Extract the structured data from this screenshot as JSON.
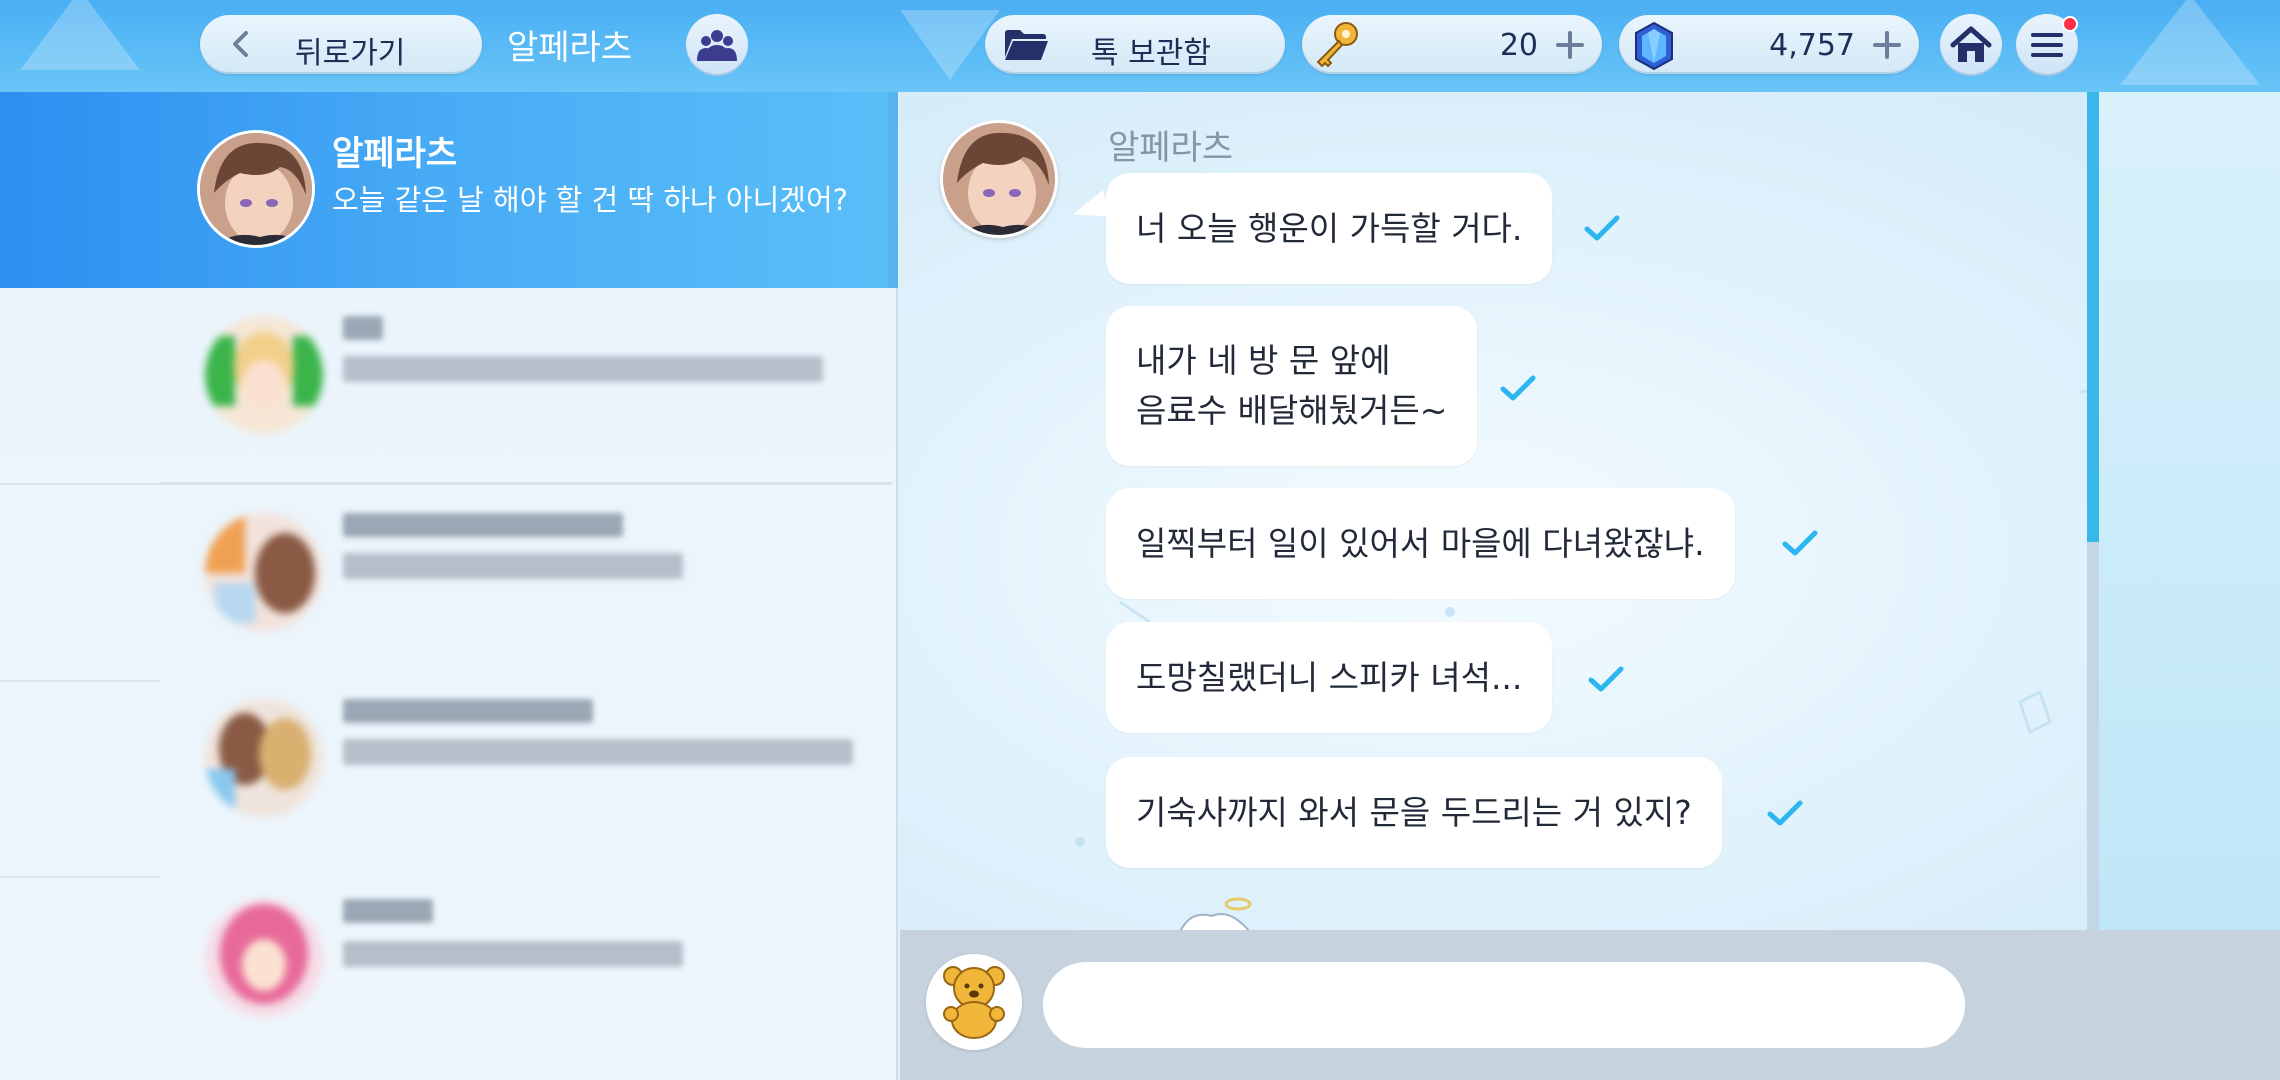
{
  "header": {
    "back_label": "뒤로가기",
    "title": "알페라츠",
    "archive_label": "톡 보관함",
    "keys": "20",
    "gems": "4,757"
  },
  "chat_list": [
    {
      "name": "알페라츠",
      "preview": "오늘 같은 날 해야 할 건 딱 하나 아니겠어?",
      "active": true
    },
    {
      "name": "",
      "preview": "",
      "blurred": true
    },
    {
      "name": "",
      "preview": "",
      "blurred": true
    },
    {
      "name": "",
      "preview": "",
      "blurred": true
    },
    {
      "name": "",
      "preview": "",
      "blurred": true
    }
  ],
  "conversation": {
    "sender": "알페라츠",
    "messages": [
      {
        "text": "너 오늘 행운이 가득할 거다."
      },
      {
        "line1": "내가 네 방 문 앞에",
        "line2": "음료수 배달해뒀거든~"
      },
      {
        "text": "일찍부터 일이 있어서 마을에 다녀왔잖냐."
      },
      {
        "text": "도망칠랬더니 스피카 녀석..."
      },
      {
        "text": "기숙사까지 와서 문을 두드리는 거 있지?"
      }
    ]
  },
  "input": {
    "placeholder": ""
  },
  "colors": {
    "accent": "#3a9ff0",
    "check": "#2bb6ef",
    "notification": "#ff3048"
  },
  "icons": [
    "chevron-left-icon",
    "group-icon",
    "folder-icon",
    "key-icon",
    "gem-icon",
    "home-icon",
    "menu-icon",
    "bear-icon",
    "check-icon"
  ]
}
